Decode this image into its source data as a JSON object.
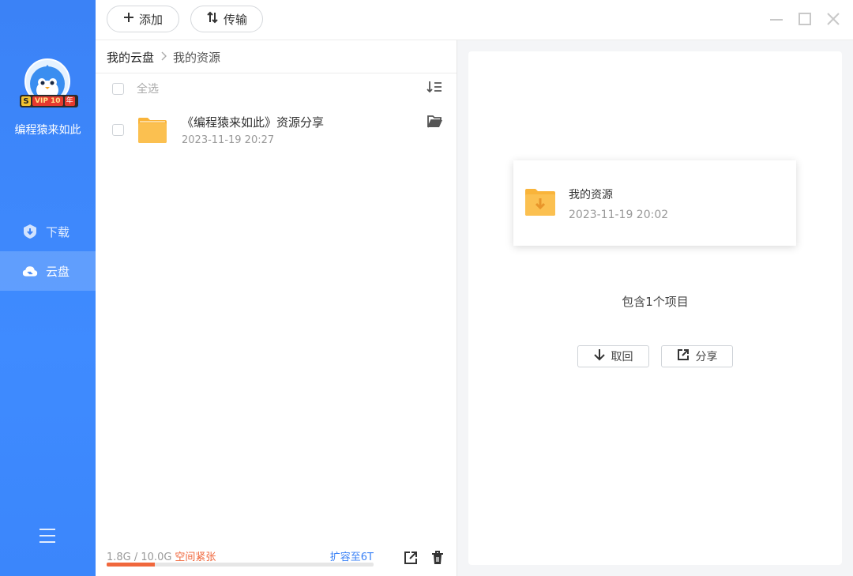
{
  "sidebar": {
    "username": "编程猿来如此",
    "vip_badge": {
      "s": "S",
      "vip": "VIP 10",
      "year": "年"
    },
    "nav": [
      {
        "label": "下载",
        "icon": "download-shield-icon",
        "active": false
      },
      {
        "label": "云盘",
        "icon": "cloud-icon",
        "active": true
      }
    ],
    "menu_icon": "hamburger-menu-icon"
  },
  "toolbar": {
    "add_label": "添加",
    "transfer_label": "传输"
  },
  "breadcrumb": {
    "root": "我的云盘",
    "current": "我的资源"
  },
  "file_list": {
    "select_all_label": "全选",
    "items": [
      {
        "name": "《编程猿来如此》资源分享",
        "date": "2023-11-19 20:27",
        "icon": "folder-icon"
      }
    ]
  },
  "storage": {
    "used_text": "1.8G / 10.0G",
    "warning": "空间紧张",
    "expand_label": "扩容至6T",
    "used_fraction": 0.18,
    "warn_color": "#f0673c"
  },
  "detail": {
    "name": "我的资源",
    "date": "2023-11-19 20:02",
    "item_count": "包含1个项目",
    "retrieve_label": "取回",
    "share_label": "分享"
  },
  "colors": {
    "accent": "#3b82f6",
    "folder": "#f9b43a"
  }
}
